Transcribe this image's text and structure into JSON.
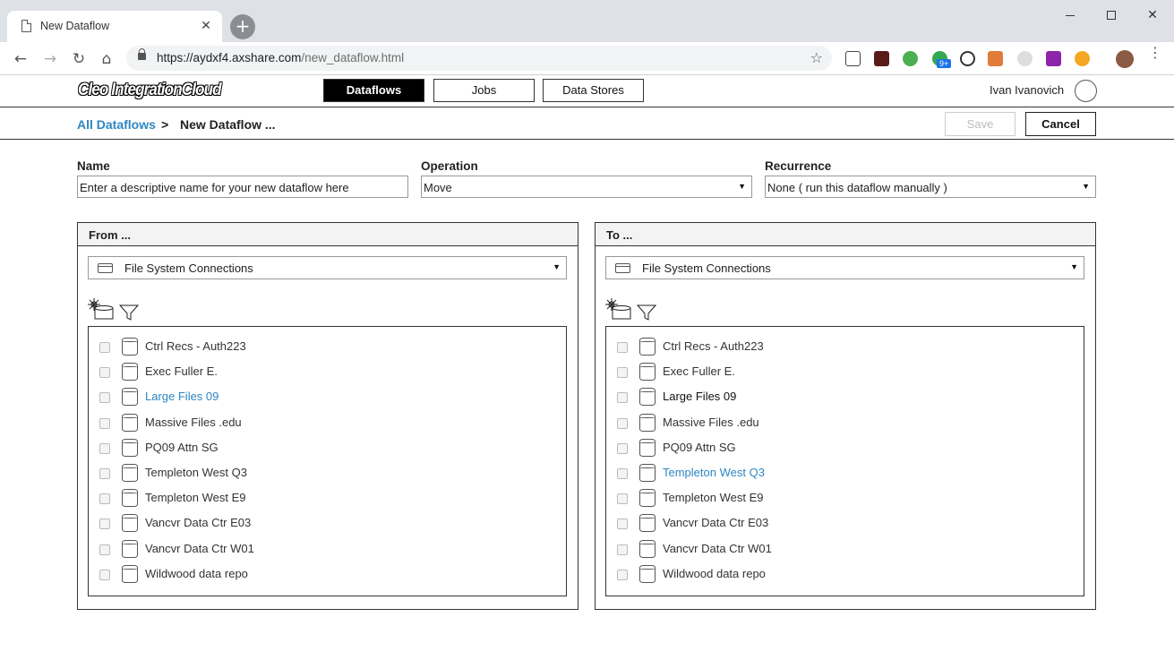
{
  "browser": {
    "tab_title": "New Dataflow",
    "tab_close": "✕",
    "new_tab": "+",
    "url_host": "https://aydxf4.axshare.com",
    "url_path": "/new_dataflow.html",
    "ext_badge": "9+"
  },
  "header": {
    "logo": "Cleo IntegrationCloud",
    "nav": [
      "Dataflows",
      "Jobs",
      "Data Stores"
    ],
    "active_nav": "Dataflows",
    "user": "Ivan Ivanovich"
  },
  "breadcrumb": {
    "root": "All Dataflows",
    "separator": ">",
    "current": "New Dataflow ..."
  },
  "actions": {
    "save": "Save",
    "cancel": "Cancel"
  },
  "form": {
    "name_label": "Name",
    "name_value": "Enter a descriptive name for your new dataflow here",
    "operation_label": "Operation",
    "operation_value": "Move",
    "recurrence_label": "Recurrence",
    "recurrence_value": "None ( run this dataflow manually )"
  },
  "from_panel": {
    "title": "From ...",
    "connection": "File System Connections",
    "items": [
      "Ctrl Recs - Auth223",
      "Exec Fuller E.",
      "Large Files 09",
      "Massive Files .edu",
      "PQ09 Attn SG",
      "Templeton West Q3",
      "Templeton West E9",
      "Vancvr Data Ctr E03",
      "Vancvr Data Ctr W01",
      "Wildwood data repo"
    ],
    "highlighted": "Large Files 09"
  },
  "to_panel": {
    "title": "To ...",
    "connection": "File System Connections",
    "items": [
      "Ctrl Recs - Auth223",
      "Exec Fuller E.",
      "Large Files 09",
      "Massive Files .edu",
      "PQ09 Attn SG",
      "Templeton West Q3",
      "Templeton West E9",
      "Vancvr Data Ctr E03",
      "Vancvr Data Ctr W01",
      "Wildwood data repo"
    ],
    "highlighted": "Templeton West Q3",
    "disabled_highlight": "Large Files 09"
  },
  "colors": {
    "link": "#2f86c1",
    "active_nav_bg": "#000000"
  }
}
